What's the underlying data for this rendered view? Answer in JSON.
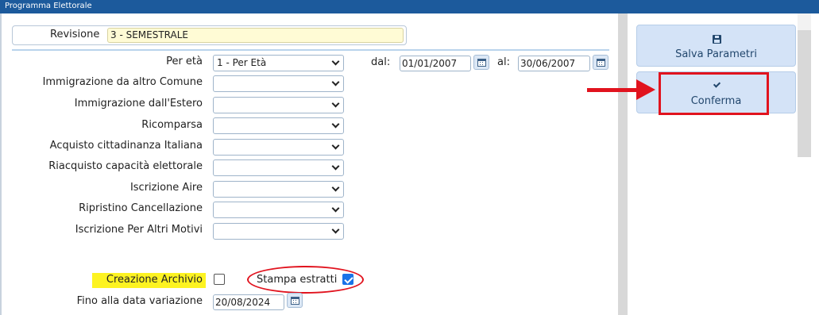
{
  "window": {
    "title": "Programma Elettorale"
  },
  "revisione": {
    "label": "Revisione",
    "value": "3 - SEMESTRALE"
  },
  "form": {
    "fields": [
      {
        "label": "Per età",
        "value": "1 - Per Età"
      },
      {
        "label": "Immigrazione da altro Comune",
        "value": ""
      },
      {
        "label": "Immigrazione dall'Estero",
        "value": ""
      },
      {
        "label": "Ricomparsa",
        "value": ""
      },
      {
        "label": "Acquisto cittadinanza Italiana",
        "value": ""
      },
      {
        "label": "Riacquisto capacità elettorale",
        "value": ""
      },
      {
        "label": "Iscrizione Aire",
        "value": ""
      },
      {
        "label": "Ripristino Cancellazione",
        "value": ""
      },
      {
        "label": "Iscrizione Per Altri Motivi",
        "value": ""
      }
    ],
    "dal": {
      "label": "dal:",
      "value": "01/01/2007"
    },
    "al": {
      "label": "al:",
      "value": "30/06/2007"
    },
    "creazione_archivio": {
      "label": "Creazione Archivio",
      "checked": false
    },
    "stampa_estratti": {
      "label": "Stampa estratti",
      "checked": true
    },
    "fino_data": {
      "label": "Fino alla data variazione",
      "value": "20/08/2024"
    }
  },
  "actions": {
    "salva": {
      "label": "Salva Parametri",
      "icon": "floppy-disk-icon"
    },
    "conferma": {
      "label": "Conferma",
      "icon": "checkmark-icon"
    }
  },
  "annotations": {
    "highlight_color": "#fdf321",
    "marker_color": "#e1131e"
  }
}
